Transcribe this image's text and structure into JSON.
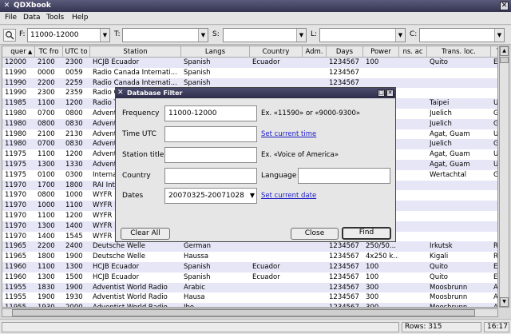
{
  "window": {
    "title": "QDXbook",
    "close_glyph": "✕"
  },
  "menu": [
    "File",
    "Data",
    "Tools",
    "Help"
  ],
  "toolbar": {
    "filters": [
      {
        "label": "F:",
        "value": "11000-12000"
      },
      {
        "label": "T:",
        "value": ""
      },
      {
        "label": "S:",
        "value": ""
      },
      {
        "label": "L:",
        "value": ""
      },
      {
        "label": "C:",
        "value": ""
      }
    ]
  },
  "table": {
    "columns": [
      "quer",
      "TC fro",
      "UTC to",
      "Station",
      "Langs",
      "Country",
      "Adm.",
      "Days",
      "Power",
      "ns. ac",
      "Trans. loc.",
      "T"
    ],
    "rows": [
      [
        "12000",
        "2100",
        "2300",
        "HCJB Ecuador",
        "Spanish",
        "Ecuador",
        "",
        "1234567",
        "100",
        "",
        "Quito",
        "E"
      ],
      [
        "11990",
        "0000",
        "0059",
        "Radio Canada Internati...",
        "Spanish",
        "",
        "",
        "1234567",
        "",
        "",
        "",
        ""
      ],
      [
        "11990",
        "2200",
        "2259",
        "Radio Canada Internati...",
        "Spanish",
        "",
        "",
        "1234567",
        "",
        "",
        "",
        ""
      ],
      [
        "11990",
        "2300",
        "2359",
        "Radio Canada Internati...",
        "Spanish",
        "",
        "",
        "1234567",
        "",
        "",
        "",
        ""
      ],
      [
        "11985",
        "1100",
        "1200",
        "Radio T",
        "",
        "",
        "",
        "",
        "",
        "",
        "Taipei",
        "Ur"
      ],
      [
        "11980",
        "0700",
        "0800",
        "Advent",
        "",
        "",
        "",
        "",
        "",
        "",
        "Juelich",
        "Ge"
      ],
      [
        "11980",
        "0800",
        "0830",
        "Advent",
        "",
        "",
        "",
        "",
        "",
        "",
        "Juelich",
        "Ge"
      ],
      [
        "11980",
        "2100",
        "2130",
        "Advent",
        "",
        "",
        "",
        "",
        "",
        "",
        "Agat, Guam",
        "Ur"
      ],
      [
        "11980",
        "0700",
        "0830",
        "Advent",
        "",
        "",
        "",
        "",
        "",
        "",
        "Juelich",
        "Ge"
      ],
      [
        "11975",
        "1100",
        "1200",
        "Advent",
        "",
        "",
        "",
        "",
        "",
        "",
        "Agat, Guam",
        "Ur"
      ],
      [
        "11975",
        "1300",
        "1330",
        "Advent",
        "",
        "",
        "",
        "",
        "",
        "",
        "Agat, Guam",
        "Ur"
      ],
      [
        "11975",
        "0100",
        "0300",
        "Interna",
        "",
        "",
        "",
        "",
        "",
        "",
        "Wertachtal",
        "Ge"
      ],
      [
        "11970",
        "1700",
        "1800",
        "RAI Int",
        "",
        "",
        "",
        "",
        "",
        "",
        "",
        ""
      ],
      [
        "11970",
        "0800",
        "1000",
        "WYFR F",
        "",
        "",
        "",
        "",
        "",
        "",
        "",
        ""
      ],
      [
        "11970",
        "1000",
        "1100",
        "WYFR F",
        "",
        "",
        "",
        "",
        "",
        "",
        "",
        ""
      ],
      [
        "11970",
        "1100",
        "1200",
        "WYFR F",
        "",
        "",
        "",
        "",
        "",
        "",
        "",
        ""
      ],
      [
        "11970",
        "1300",
        "1400",
        "WYFR F",
        "",
        "",
        "",
        "",
        "",
        "",
        "",
        ""
      ],
      [
        "11970",
        "1400",
        "1545",
        "WYFR F",
        "",
        "",
        "",
        "",
        "",
        "",
        "",
        ""
      ],
      [
        "11965",
        "2200",
        "2400",
        "Deutsche Welle",
        "German",
        "",
        "",
        "1234567",
        "250/50...",
        "",
        "Irkutsk",
        "Ru"
      ],
      [
        "11965",
        "1800",
        "1900",
        "Deutsche Welle",
        "Haussa",
        "",
        "",
        "1234567",
        "4x250 k...",
        "",
        "Kigali",
        "Rw"
      ],
      [
        "11960",
        "1100",
        "1300",
        "HCJB Ecuador",
        "Spanish",
        "Ecuador",
        "",
        "1234567",
        "100",
        "",
        "Quito",
        "Ec"
      ],
      [
        "11960",
        "1300",
        "1500",
        "HCJB Ecuador",
        "Spanish",
        "Ecuador",
        "",
        "1234567",
        "100",
        "",
        "Quito",
        "Ec"
      ],
      [
        "11955",
        "1830",
        "1900",
        "Adventist World Radio",
        "Arabic",
        "",
        "",
        "1234567",
        "300",
        "",
        "Moosbrunn",
        "Au"
      ],
      [
        "11955",
        "1900",
        "1930",
        "Adventist World Radio",
        "Hausa",
        "",
        "",
        "1234567",
        "300",
        "",
        "Moosbrunn",
        "Au"
      ],
      [
        "11955",
        "1930",
        "2000",
        "Adventist World Radio",
        "Ibo",
        "",
        "",
        "1234567",
        "300",
        "",
        "Moosbrunn",
        "Au"
      ]
    ]
  },
  "status": {
    "rows": "Rows: 315",
    "time": "16:17"
  },
  "dialog": {
    "title": "Database Filter",
    "frequency_label": "Frequency",
    "frequency_value": "11000-12000",
    "frequency_hint": "Ex. «11590» or «9000-9300»",
    "time_label": "Time UTC",
    "time_value": "",
    "time_link": "Set current time",
    "station_label": "Station title",
    "station_value": "",
    "station_hint": "Ex. «Voice of America»",
    "country_label": "Country",
    "country_value": "",
    "language_label": "Language",
    "language_value": "",
    "dates_label": "Dates",
    "dates_value": "20070325-20071028",
    "dates_link": "Set current date",
    "clear_label": "Clear All",
    "close_label": "Close",
    "find_label": "Find"
  }
}
